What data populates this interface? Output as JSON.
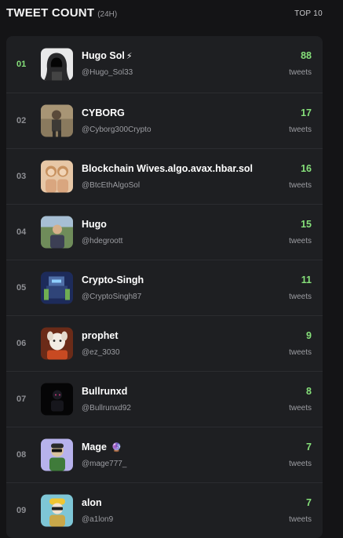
{
  "header": {
    "title": "TWEET COUNT",
    "period": "(24H)",
    "top_label": "TOP 10"
  },
  "accent_color": "#86e07a",
  "rows": [
    {
      "rank": "01",
      "name": "Hugo Sol",
      "badge": "⚡",
      "handle": "@Hugo_Sol33",
      "count": "88",
      "unit": "tweets",
      "avatar_icon": "hooded-figure-avatar"
    },
    {
      "rank": "02",
      "name": "CYBORG",
      "badge": "",
      "handle": "@Cyborg300Crypto",
      "count": "17",
      "unit": "tweets",
      "avatar_icon": "cyborg-character-avatar"
    },
    {
      "rank": "03",
      "name": "Blockchain Wives.algo.avax.hbar.sol",
      "badge": "",
      "handle": "@BtcEthAlgoSol",
      "count": "16",
      "unit": "tweets",
      "avatar_icon": "two-women-avatar"
    },
    {
      "rank": "04",
      "name": "Hugo",
      "badge": "",
      "handle": "@hdegroott",
      "count": "15",
      "unit": "tweets",
      "avatar_icon": "person-outdoors-avatar"
    },
    {
      "rank": "05",
      "name": "Crypto-Singh",
      "badge": "",
      "handle": "@CryptoSingh87",
      "count": "11",
      "unit": "tweets",
      "avatar_icon": "robot-mech-avatar"
    },
    {
      "rank": "06",
      "name": "prophet",
      "badge": "",
      "handle": "@ez_3030",
      "count": "9",
      "unit": "tweets",
      "avatar_icon": "dog-avatar"
    },
    {
      "rank": "07",
      "name": "Bullrunxd",
      "badge": "",
      "handle": "@Bullrunxd92",
      "count": "8",
      "unit": "tweets",
      "avatar_icon": "dark-figure-avatar"
    },
    {
      "rank": "08",
      "name": "Mage",
      "badge": "🔮",
      "handle": "@mage777_",
      "count": "7",
      "unit": "tweets",
      "avatar_icon": "cartoon-character-avatar"
    },
    {
      "rank": "09",
      "name": "alon",
      "badge": "",
      "handle": "@a1lon9",
      "count": "7",
      "unit": "tweets",
      "avatar_icon": "cartoon-worker-avatar"
    }
  ]
}
